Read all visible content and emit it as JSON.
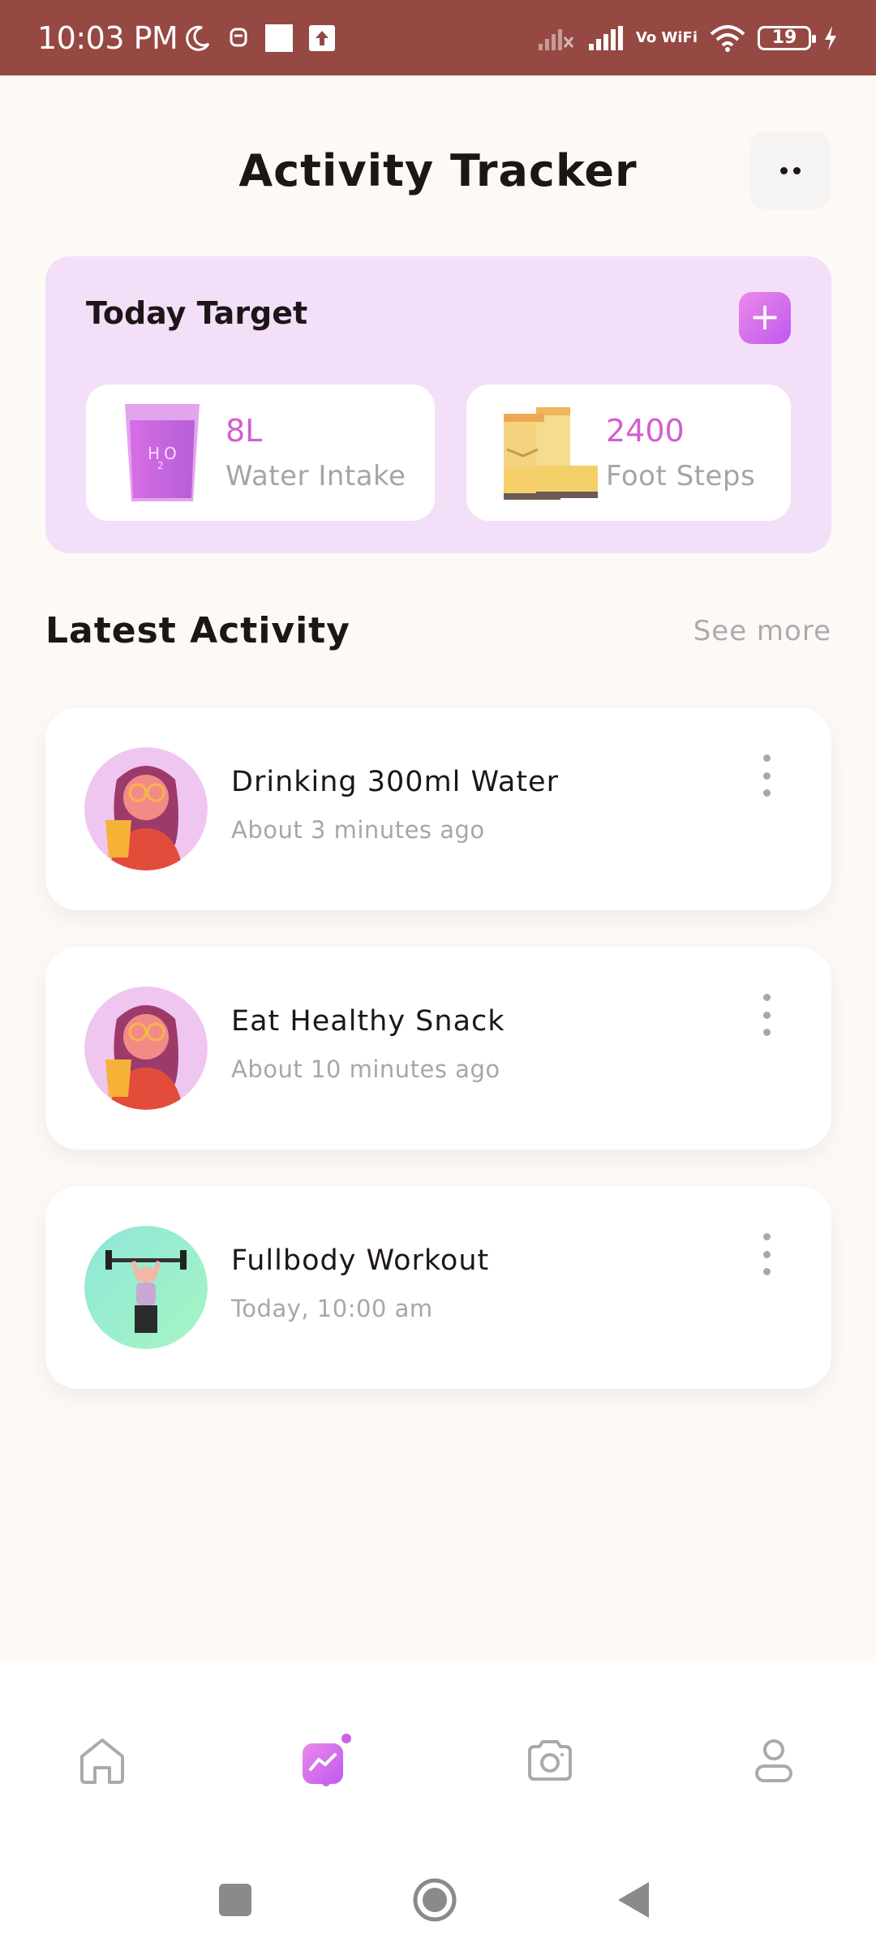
{
  "status_bar": {
    "time": "10:03 PM",
    "battery": "19",
    "vowifi": "Vo WiFi",
    "icons": [
      "moon-icon",
      "notification-icon",
      "square-icon",
      "upload-icon",
      "signal-x-icon",
      "signal-icon",
      "wifi-icon",
      "battery-icon",
      "charging-icon"
    ]
  },
  "header": {
    "title": "Activity Tracker",
    "more_icon": "more-dots-icon"
  },
  "today_target": {
    "title": "Today Target",
    "add_icon": "plus-icon",
    "items": [
      {
        "value": "8L",
        "label": "Water Intake",
        "icon": "water-glass-icon"
      },
      {
        "value": "2400",
        "label": "Foot Steps",
        "icon": "boots-icon"
      }
    ]
  },
  "latest_activity": {
    "title": "Latest Activity",
    "see_more": "See more",
    "items": [
      {
        "title": "Drinking 300ml Water",
        "time": "About 3 minutes ago",
        "avatar": "woman-drinking-avatar"
      },
      {
        "title": "Eat Healthy Snack",
        "time": "About 10 minutes ago",
        "avatar": "woman-drinking-avatar"
      },
      {
        "title": "Fullbody Workout",
        "time": "Today, 10:00 am",
        "avatar": "weightlifter-avatar"
      }
    ]
  },
  "bottom_nav": {
    "items": [
      {
        "name": "home",
        "icon": "home-icon",
        "active": false
      },
      {
        "name": "activity",
        "icon": "activity-chart-icon",
        "active": true
      },
      {
        "name": "camera",
        "icon": "camera-icon",
        "active": false
      },
      {
        "name": "profile",
        "icon": "profile-icon",
        "active": false
      }
    ]
  },
  "colors": {
    "status_bar": "#964843",
    "accent": "#c964e8",
    "target_card_bg": "#f3dff8",
    "value_pink": "#d35ed2"
  }
}
